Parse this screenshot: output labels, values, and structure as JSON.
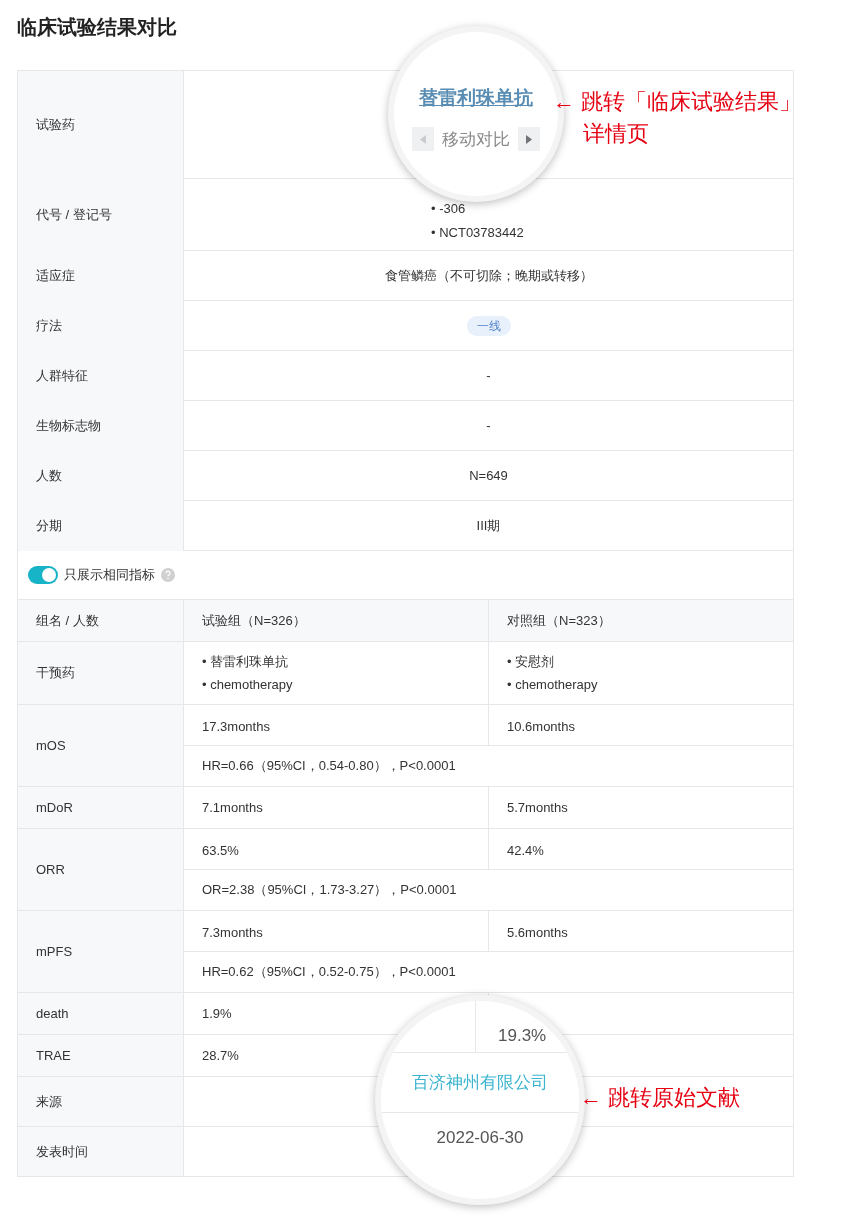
{
  "title": "临床试验结果对比",
  "summary_rows": [
    {
      "label": "试验药",
      "kind": "drug"
    },
    {
      "label": "代号 / 登记号",
      "kind": "codes",
      "values": [
        "• -306",
        "• NCT03783442"
      ]
    },
    {
      "label": "适应症",
      "kind": "text",
      "value": "食管鳞癌（不可切除；晚期或转移）"
    },
    {
      "label": "疗法",
      "kind": "badge",
      "value": "一线"
    },
    {
      "label": "人群特征",
      "kind": "text",
      "value": "-"
    },
    {
      "label": "生物标志物",
      "kind": "text",
      "value": "-"
    },
    {
      "label": "人数",
      "kind": "text",
      "value": "N=649"
    },
    {
      "label": "分期",
      "kind": "text",
      "value": "III期"
    }
  ],
  "toggle": {
    "label": "只展示相同指标",
    "on": true
  },
  "header": {
    "label": "组名 / 人数",
    "columns": [
      "试验组（N=326）",
      "对照组（N=323）"
    ]
  },
  "metric_rows": [
    {
      "label": "干预药",
      "kind": "list",
      "values": [
        [
          "• 替雷利珠单抗",
          "• chemotherapy"
        ],
        [
          "• 安慰剂",
          "• chemotherapy"
        ]
      ]
    },
    {
      "label": "mOS",
      "kind": "split",
      "values": [
        "17.3months",
        "10.6months"
      ],
      "note": "HR=0.66（95%CI，0.54-0.80），P<0.0001"
    },
    {
      "label": "mDoR",
      "kind": "split",
      "values": [
        "7.1months",
        "5.7months"
      ]
    },
    {
      "label": "ORR",
      "kind": "split",
      "values": [
        "63.5%",
        "42.4%"
      ],
      "note": "OR=2.38（95%CI，1.73-3.27），P<0.0001"
    },
    {
      "label": "mPFS",
      "kind": "split",
      "values": [
        "7.3months",
        "5.6months"
      ],
      "note": "HR=0.62（95%CI，0.52-0.75），P<0.0001"
    },
    {
      "label": "death",
      "kind": "split",
      "values": [
        "1.9%"
      ]
    },
    {
      "label": "TRAE",
      "kind": "split",
      "values": [
        "28.7%"
      ]
    },
    {
      "label": "来源",
      "kind": "blank"
    },
    {
      "label": "发表时间",
      "kind": "blank"
    }
  ],
  "magnifiers": [
    {
      "kind": "drug",
      "link": "替雷利珠单抗",
      "move_label": "移动对比",
      "annotation": "← 跳转「临床试验结果」",
      "annotation_2": "详情页"
    },
    {
      "kind": "source",
      "value": "19.3%",
      "source": "百济神州有限公司",
      "date": "2022-06-30",
      "annotation": "← 跳转原始文献"
    }
  ]
}
